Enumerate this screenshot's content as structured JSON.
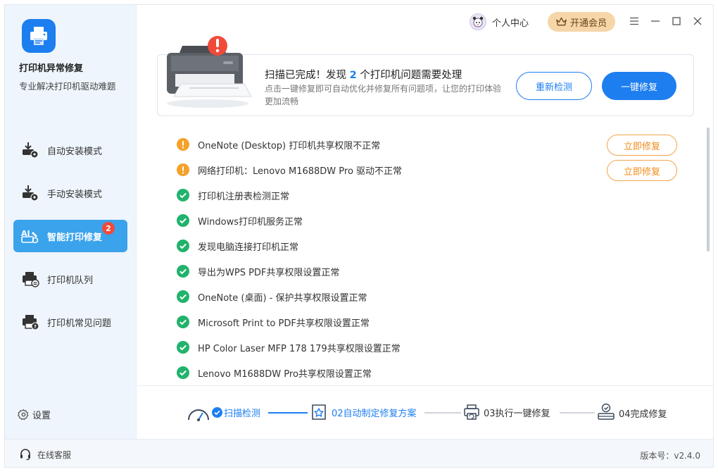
{
  "app": {
    "title": "打印机异常修复",
    "subtitle": "专业解决打印机驱动难题"
  },
  "sidebar": {
    "items": [
      {
        "label": "自动安装模式",
        "icon": "auto-install-icon",
        "active": false
      },
      {
        "label": "手动安装模式",
        "icon": "manual-install-icon",
        "active": false
      },
      {
        "label": "智能打印修复",
        "icon": "smart-repair-icon",
        "active": true,
        "badge": "2"
      },
      {
        "label": "打印机队列",
        "icon": "printer-queue-icon",
        "active": false
      },
      {
        "label": "打印机常见问题",
        "icon": "printer-faq-icon",
        "active": false
      }
    ],
    "settings_label": "设置"
  },
  "titlebar": {
    "user_label": "个人中心",
    "vip_label": "开通会员"
  },
  "scan": {
    "title_prefix": "扫描已完成！发现",
    "issue_count": "2",
    "title_suffix": "个打印机问题需要处理",
    "description": "点击一键修复即可自动优化并修复所有问题项，让您的打印体验更加流畅",
    "rescan_label": "重新检测",
    "fix_all_label": "一键修复"
  },
  "issues": [
    {
      "text": "OneNote (Desktop) 打印机共享权限不正常",
      "status": "warning",
      "action": "立即修复"
    },
    {
      "text": "网络打印机：Lenovo M1688DW Pro 驱动不正常",
      "status": "warning",
      "action": "立即修复"
    },
    {
      "text": "打印机注册表检测正常",
      "status": "ok"
    },
    {
      "text": "Windows打印机服务正常",
      "status": "ok"
    },
    {
      "text": "发现电脑连接打印机正常",
      "status": "ok"
    },
    {
      "text": "导出为WPS PDF共享权限设置正常",
      "status": "ok"
    },
    {
      "text": "OneNote (桌面) - 保护共享权限设置正常",
      "status": "ok"
    },
    {
      "text": "Microsoft Print to PDF共享权限设置正常",
      "status": "ok"
    },
    {
      "text": "HP Color Laser MFP 178 179共享权限设置正常",
      "status": "ok"
    },
    {
      "text": "Lenovo M1688DW Pro共享权限设置正常",
      "status": "ok"
    }
  ],
  "steps": [
    {
      "label": "扫描检测",
      "state": "done"
    },
    {
      "label": "02自动制定修复方案",
      "state": "current"
    },
    {
      "label": "03执行一键修复",
      "state": "pending"
    },
    {
      "label": "04完成修复",
      "state": "pending"
    }
  ],
  "footer": {
    "support_label": "在线客服",
    "version_label": "版本号：v2.4.0"
  },
  "colors": {
    "accent": "#1d7ef0",
    "sidebar_active": "#3aa3ec",
    "warning": "#f5a12a",
    "ok": "#21b36b",
    "badge": "#f04a3a",
    "vip": "#f6d6a8"
  }
}
